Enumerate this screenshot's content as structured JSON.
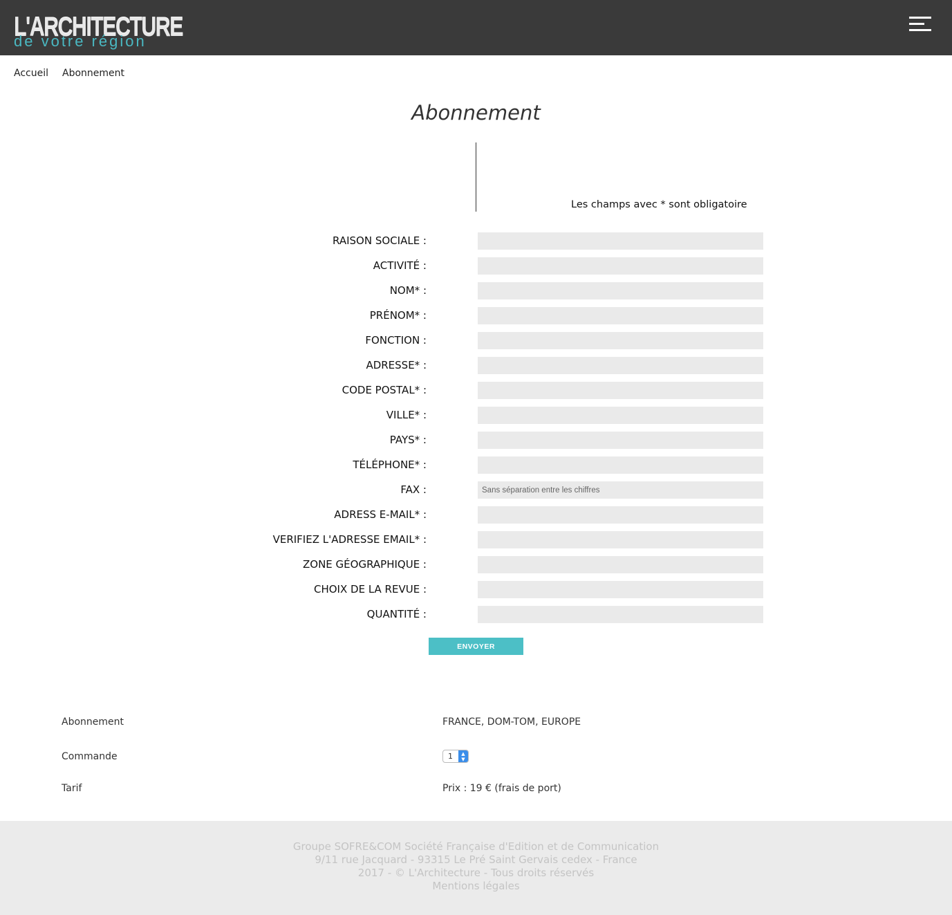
{
  "header": {
    "logo_main": "L'ARCHITECTURE",
    "logo_sub": "de votre région",
    "menu_icon": "hamburger-menu-icon"
  },
  "breadcrumb": [
    "Accueil",
    "Abonnement"
  ],
  "page_title": "Abonnement",
  "required_note": "Les champs avec * sont obligatoire",
  "form": {
    "fields": [
      {
        "label": "RAISON SOCIALE :",
        "placeholder": ""
      },
      {
        "label": "ACTIVITÉ :",
        "placeholder": ""
      },
      {
        "label": "NOM* :",
        "placeholder": ""
      },
      {
        "label": "PRÉNOM* :",
        "placeholder": ""
      },
      {
        "label": "FONCTION :",
        "placeholder": ""
      },
      {
        "label": "ADRESSE* :",
        "placeholder": ""
      },
      {
        "label": "CODE POSTAL* :",
        "placeholder": ""
      },
      {
        "label": "VILLE* :",
        "placeholder": ""
      },
      {
        "label": "PAYS* :",
        "placeholder": ""
      },
      {
        "label": "TÉLÉPHONE* :",
        "placeholder": ""
      },
      {
        "label": "FAX :",
        "placeholder": "Sans séparation entre les chiffres"
      },
      {
        "label": "ADRESS E-MAIL* :",
        "placeholder": ""
      },
      {
        "label": "VERIFIEZ L'ADRESSE EMAIL* :",
        "placeholder": ""
      },
      {
        "label": "ZONE GÉOGRAPHIQUE :",
        "placeholder": ""
      },
      {
        "label": "CHOIX DE LA REVUE :",
        "placeholder": ""
      },
      {
        "label": "QUANTITÉ :",
        "placeholder": ""
      }
    ],
    "submit_label": "ENVOYER"
  },
  "summary": {
    "subscription_label": "Abonnement",
    "subscription_value": "FRANCE, DOM-TOM, EUROPE",
    "order_label": "Commande",
    "order_quantity": "1",
    "price_label": "Tarif",
    "price_value": "Prix : 19 € (frais de port)"
  },
  "footer": {
    "lines": [
      "Groupe SOFRE&COM Société Française d'Edition et de Communication",
      "9/11 rue Jacquard - 93315 Le Pré Saint Gervais cedex - France",
      "2017 - © L'Architecture - Tous droits réservés",
      "Mentions légales"
    ]
  },
  "colors": {
    "header_bg": "#3a3a3a",
    "accent": "#4cbfc6",
    "field_bg": "#eaeaea",
    "footer_bg": "#ebebeb"
  }
}
